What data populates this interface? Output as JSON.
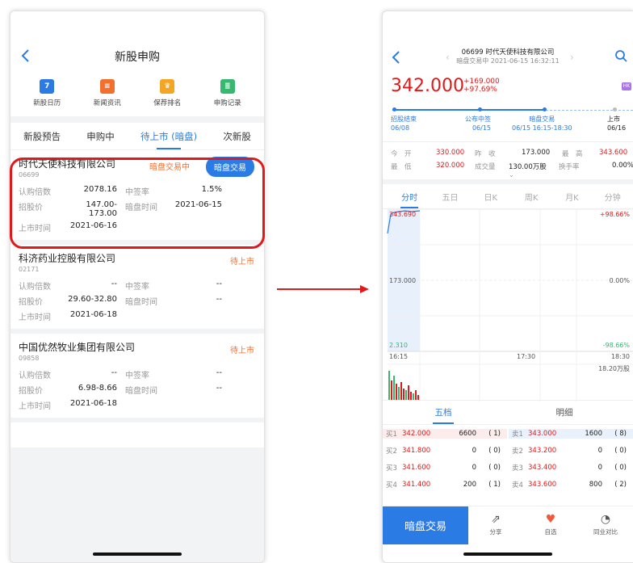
{
  "left": {
    "title": "新股申购",
    "shortcuts": [
      {
        "label": "新股日历",
        "icon": "calendar-icon",
        "glyph": "7",
        "color": "#2b7be4"
      },
      {
        "label": "新闻资讯",
        "icon": "news-icon",
        "glyph": "≡",
        "color": "#f36f2c"
      },
      {
        "label": "保荐排名",
        "icon": "trophy-icon",
        "glyph": "♛",
        "color": "#f2a623"
      },
      {
        "label": "申购记录",
        "icon": "record-icon",
        "glyph": "≣",
        "color": "#36b870"
      }
    ],
    "tabs": [
      "新股预告",
      "申购中",
      "待上市 (暗盘)",
      "次新股"
    ],
    "cards": [
      {
        "name": "时代天使科技有限公司",
        "code": "06699",
        "status": "暗盘交易中",
        "button": "暗盘交易",
        "l1": "认购倍数",
        "v1": "2078.16",
        "l2": "中签率",
        "v2": "1.5%",
        "l3": "招股价",
        "v3": "147.00-173.00",
        "l4": "暗盘时间",
        "v4": "2021-06-15",
        "l5": "上市时间",
        "v5": "2021-06-16"
      },
      {
        "name": "科济药业控股有限公司",
        "code": "02171",
        "status": "待上市",
        "button": "",
        "l1": "认购倍数",
        "v1": "--",
        "l2": "中签率",
        "v2": "--",
        "l3": "招股价",
        "v3": "29.60-32.80",
        "l4": "暗盘时间",
        "v4": "--",
        "l5": "上市时间",
        "v5": "2021-06-18"
      },
      {
        "name": "中国优然牧业集团有限公司",
        "code": "09858",
        "status": "待上市",
        "button": "",
        "l1": "认购倍数",
        "v1": "--",
        "l2": "中签率",
        "v2": "--",
        "l3": "招股价",
        "v3": "6.98-8.66",
        "l4": "暗盘时间",
        "v4": "--",
        "l5": "上市时间",
        "v5": "2021-06-18"
      }
    ]
  },
  "right": {
    "title": "06699 时代天使科技有限公司",
    "subtitle": "暗盘交易中 2021-06-15 16:32:11",
    "price": "342.000",
    "change": "+169.000",
    "change_pct": "+97.69%",
    "market_badge": "HK",
    "timeline": [
      {
        "label": "招股结束",
        "date": "06/08"
      },
      {
        "label": "公布中签",
        "date": "06/15"
      },
      {
        "label": "暗盘交易",
        "date": "06/15 16:15-18:30"
      },
      {
        "label": "上市",
        "date": "06/16"
      }
    ],
    "stats": {
      "open_label": "今　开",
      "open": "330.000",
      "prev_label": "昨　收",
      "prev": "173.000",
      "high_label": "最　高",
      "high": "343.600",
      "low_label": "最　低",
      "low": "320.000",
      "vol_label": "成交量",
      "vol": "130.00万股",
      "turn_label": "换手率",
      "turn": "0.00%"
    },
    "chart_tabs": [
      "分时",
      "五日",
      "日K",
      "周K",
      "月K",
      "分钟"
    ],
    "chart_labels": {
      "y_top": "343.690",
      "y_mid": "173.000",
      "y_bot": "2.310",
      "pct_top": "+98.66%",
      "pct_mid": "0.00%",
      "pct_bot": "-98.66%",
      "t_start": "16:15",
      "t_mid": "17:30",
      "t_end": "18:30",
      "vol_max": "18.20万股"
    },
    "depth_tabs": [
      "五档",
      "明细"
    ],
    "orderbook": [
      {
        "bl": "买1",
        "bp": "342.000",
        "bv": "6600",
        "bc": "( 1)",
        "al": "卖1",
        "ap": "343.000",
        "av": "1600",
        "ac": "( 8)"
      },
      {
        "bl": "买2",
        "bp": "341.800",
        "bv": "0",
        "bc": "( 0)",
        "al": "卖2",
        "ap": "343.200",
        "av": "0",
        "ac": "( 0)"
      },
      {
        "bl": "买3",
        "bp": "341.600",
        "bv": "0",
        "bc": "( 0)",
        "al": "卖3",
        "ap": "343.400",
        "av": "0",
        "ac": "( 0)"
      },
      {
        "bl": "买4",
        "bp": "341.400",
        "bv": "200",
        "bc": "( 1)",
        "al": "卖4",
        "ap": "343.600",
        "av": "800",
        "ac": "( 2)"
      }
    ],
    "bottom": {
      "trade": "暗盘交易",
      "share": "分享",
      "favorite": "自选",
      "compare": "同业对比"
    }
  },
  "colors": {
    "accent": "#2b7be4",
    "up": "#e0191a",
    "status": "#f36f2c",
    "highlight": "#e0191a"
  }
}
